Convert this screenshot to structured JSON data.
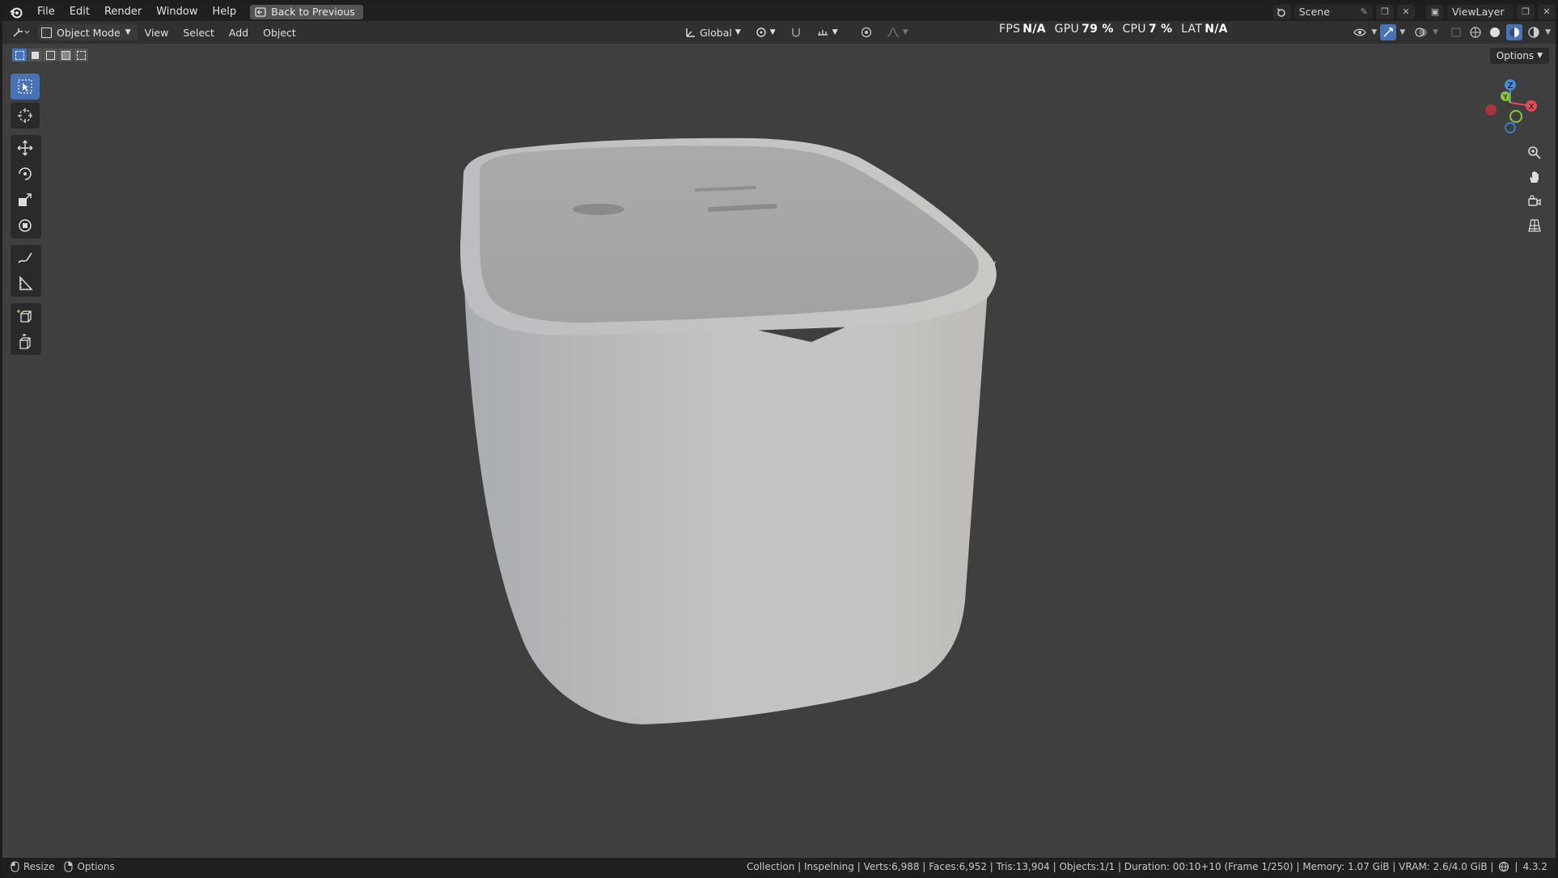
{
  "menubar": {
    "items": [
      "File",
      "Edit",
      "Render",
      "Window",
      "Help"
    ],
    "back_button": "Back to Previous",
    "scene_name": "Scene",
    "view_layer": "ViewLayer"
  },
  "header": {
    "mode": "Object Mode",
    "menus": [
      "View",
      "Select",
      "Add",
      "Object"
    ],
    "orientation": "Global",
    "stats": {
      "fps_label": "FPS",
      "fps_value": "N/A",
      "gpu_label": "GPU",
      "gpu_value": "79 %",
      "cpu_label": "CPU",
      "cpu_value": "7 %",
      "lat_label": "LAT",
      "lat_value": "N/A"
    }
  },
  "viewport": {
    "options_label": "Options",
    "gizmo_axes": {
      "x": "X",
      "y": "Y",
      "z": "Z"
    }
  },
  "statusbar": {
    "hint_resize": "Resize",
    "hint_options": "Options",
    "info": "Collection | Inspelning | Verts:6,988 | Faces:6,952 | Tris:13,904 | Objects:1/1 | Duration: 00:10+10 (Frame 1/250) | Memory: 1.07 GiB | VRAM: 2.6/4.0 GiB |",
    "version": "4.3.2"
  },
  "colors": {
    "accent": "#4772b3",
    "viewport_bg": "#3f3f3f",
    "header_bg": "#303030",
    "menubar_bg": "#1f1f1f",
    "axis_x": "#e44b5a",
    "axis_y": "#8bc43f",
    "axis_z": "#3d8ee0"
  }
}
